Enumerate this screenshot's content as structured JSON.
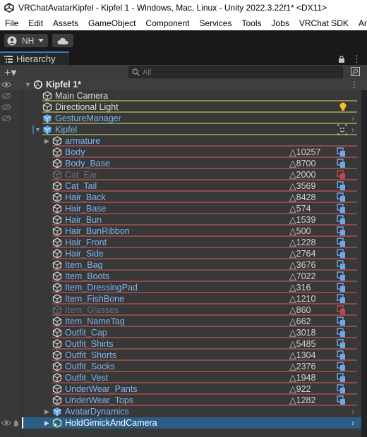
{
  "window": {
    "title": "VRChatAvatarKipfel - Kipfel 1 - Windows, Mac, Linux - Unity 2022.3.22f1* <DX11>"
  },
  "menu": [
    "File",
    "Edit",
    "Assets",
    "GameObject",
    "Component",
    "Services",
    "Tools",
    "Jobs",
    "VRChat SDK",
    "Aramaa"
  ],
  "toolbar": {
    "account_initials": "NH"
  },
  "tab": {
    "label": "Hierarchy"
  },
  "search": {
    "placeholder": "All"
  },
  "scene": {
    "name": "Kipfel 1*"
  },
  "rows": [
    {
      "name": "Main Camera",
      "color": "white"
    },
    {
      "name": "Directional Light",
      "color": "white"
    },
    {
      "name": "GestureManager",
      "color": "blue"
    },
    {
      "name": "Kipfel",
      "color": "blue"
    },
    {
      "name": "armature",
      "color": "blue"
    },
    {
      "name": "Body",
      "tris": "△10257",
      "color": "blue"
    },
    {
      "name": "Body_Base",
      "tris": "△8700",
      "color": "blue"
    },
    {
      "name": "Cat_Ear",
      "tris": "△2000",
      "color": "dim"
    },
    {
      "name": "Cat_Tail",
      "tris": "△3569",
      "color": "blue"
    },
    {
      "name": "Hair_Back",
      "tris": "△8428",
      "color": "blue"
    },
    {
      "name": "Hair_Base",
      "tris": "△574",
      "color": "blue"
    },
    {
      "name": "Hair_Bun",
      "tris": "△1539",
      "color": "blue"
    },
    {
      "name": "Hair_BunRibbon",
      "tris": "△500",
      "color": "blue"
    },
    {
      "name": "Hair_Front",
      "tris": "△1228",
      "color": "blue"
    },
    {
      "name": "Hair_Side",
      "tris": "△2764",
      "color": "blue"
    },
    {
      "name": "Item_Bag",
      "tris": "△3676",
      "color": "blue"
    },
    {
      "name": "Item_Boots",
      "tris": "△7022",
      "color": "blue"
    },
    {
      "name": "Item_DressingPad",
      "tris": "△316",
      "color": "blue"
    },
    {
      "name": "Item_FishBone",
      "tris": "△1210",
      "color": "blue"
    },
    {
      "name": "Item_Glasses",
      "tris": "△860",
      "color": "dim"
    },
    {
      "name": "Item_NameTag",
      "tris": "△662",
      "color": "blue"
    },
    {
      "name": "Outfit_Cap",
      "tris": "△3018",
      "color": "blue"
    },
    {
      "name": "Outfit_Shirts",
      "tris": "△5485",
      "color": "blue"
    },
    {
      "name": "Outfit_Shorts",
      "tris": "△1304",
      "color": "blue"
    },
    {
      "name": "Outfit_Socks",
      "tris": "△2376",
      "color": "blue"
    },
    {
      "name": "Outfit_Vest",
      "tris": "△1948",
      "color": "blue"
    },
    {
      "name": "UnderWear_Pants",
      "tris": "△922",
      "color": "blue"
    },
    {
      "name": "UnderWear_Tops",
      "tris": "△1282",
      "color": "blue"
    },
    {
      "name": "AvatarDynamics",
      "color": "blue"
    },
    {
      "name": "HoldGimickAndCamera",
      "color": "white"
    }
  ],
  "colors": {
    "prefab_blue": "#7cb5f2",
    "inactive": "#6d6f77",
    "selection": "#2c5d87",
    "accent_tab": "#3a79bb"
  }
}
